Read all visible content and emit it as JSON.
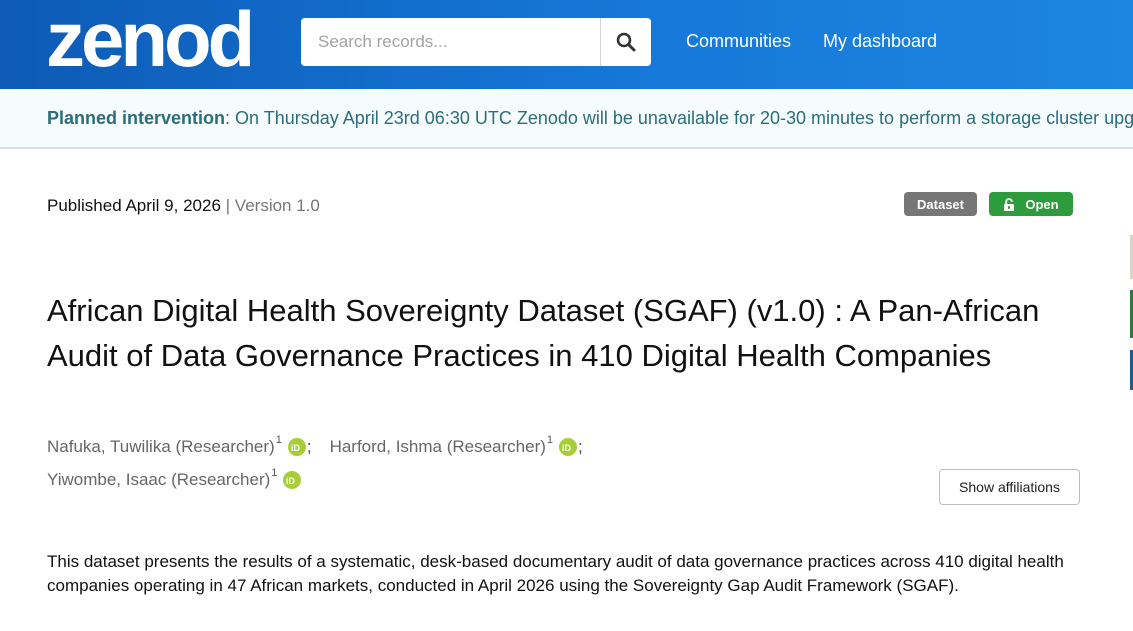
{
  "header": {
    "logo_text": "zenodo",
    "search": {
      "placeholder": "Search records..."
    },
    "nav": [
      {
        "label": "Communities"
      },
      {
        "label": "My dashboard"
      }
    ]
  },
  "banner": {
    "label": "Planned intervention",
    "message": ": On Thursday April 23rd 06:30 UTC Zenodo will be unavailable for 20-30 minutes to perform a storage cluster upgrade."
  },
  "record": {
    "published": "Published April 9, 2026",
    "separator": "|",
    "version": "Version 1.0",
    "resource_type_badge": "Dataset",
    "access_badge": "Open",
    "title": "African Digital Health Sovereignty Dataset (SGAF) (v1.0) : A Pan-African Audit of Data Governance Practices in 410 Digital Health Companies",
    "creators": [
      {
        "name": "Nafuka, Tuwilika (Researcher)",
        "affiliation_ref": "1"
      },
      {
        "name": "Harford, Ishma (Researcher)",
        "affiliation_ref": "1"
      },
      {
        "name": "Yiwombe, Isaac (Researcher)",
        "affiliation_ref": "1"
      }
    ],
    "creator_separator": ";",
    "show_affiliations_label": "Show affiliations",
    "description": "This dataset presents the results of a systematic, desk-based documentary audit of data governance practices across 410 digital health companies operating in 47 African markets, conducted in April 2026 using the Sovereignty Gap Audit Framework (SGAF)."
  },
  "colors": {
    "header_start": "#0d5bb5",
    "header_end": "#1c86e0",
    "banner_text": "#2a6d7c",
    "badge_dataset": "#767676",
    "badge_open": "#2d9c3c",
    "orcid": "#a6ce39"
  },
  "icons": {
    "search": "search-icon",
    "lock": "unlock-icon",
    "orcid": "orcid-icon"
  }
}
